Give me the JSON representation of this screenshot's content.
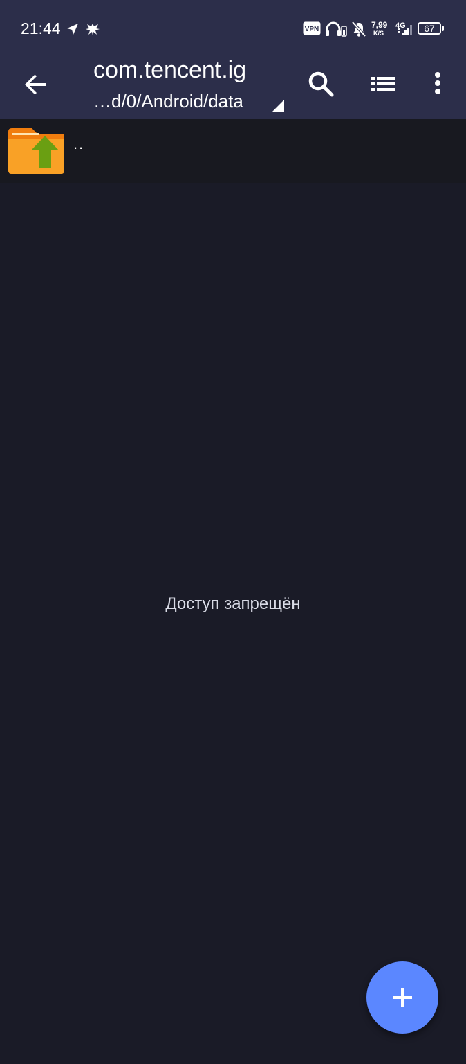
{
  "status_bar": {
    "time": "21:44",
    "vpn_label": "VPN",
    "net_speed_value": "7,99",
    "net_speed_unit": "K/S",
    "network_type": "4G",
    "battery_level": "67",
    "icons": [
      "location-arrow-icon",
      "bird-emblem-icon",
      "vpn-badge",
      "headphones-battery-icon",
      "bell-off-icon",
      "signal-icon",
      "battery-icon"
    ]
  },
  "app_bar": {
    "title": "com.tencent.ig",
    "path": "…d/0/Android/data",
    "icons": [
      "back-arrow-icon",
      "search-icon",
      "list-view-icon",
      "more-vert-icon"
    ]
  },
  "file_list": {
    "items": [
      {
        "name": "..",
        "icon": "folder-up-icon"
      }
    ]
  },
  "main": {
    "message": "Доступ запрещён"
  },
  "fab": {
    "icon": "plus-icon"
  },
  "colors": {
    "bar": "#2c2e4a",
    "background": "#1a1b27",
    "fab": "#5b87ff",
    "folder": "#f9a126",
    "folder_arrow": "#6a9f12"
  }
}
